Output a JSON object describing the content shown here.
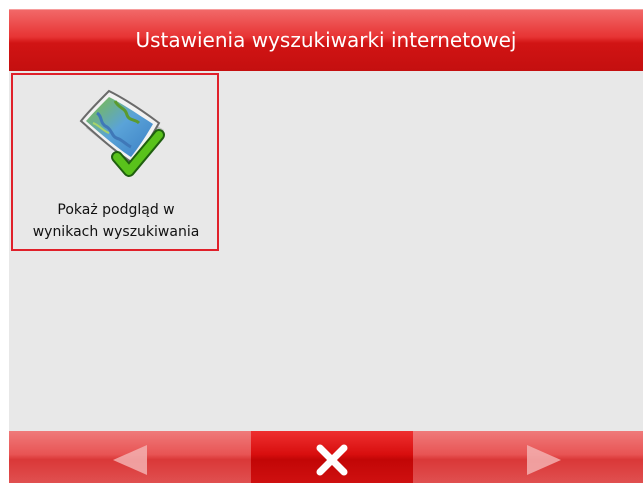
{
  "header": {
    "title": "Ustawienia wyszukiwarki internetowej"
  },
  "settings": {
    "items": [
      {
        "label_line1": "Pokaż podgląd w",
        "label_line2": "wynikach wyszukiwania",
        "icon": "map-checkmark-icon",
        "selected": true
      }
    ]
  },
  "footer": {
    "prev_icon": "arrow-left-icon",
    "close_icon": "close-icon",
    "next_icon": "arrow-right-icon"
  },
  "colors": {
    "accent": "#e0202a",
    "header_red": "#d11414",
    "background": "#e8e8e8"
  }
}
